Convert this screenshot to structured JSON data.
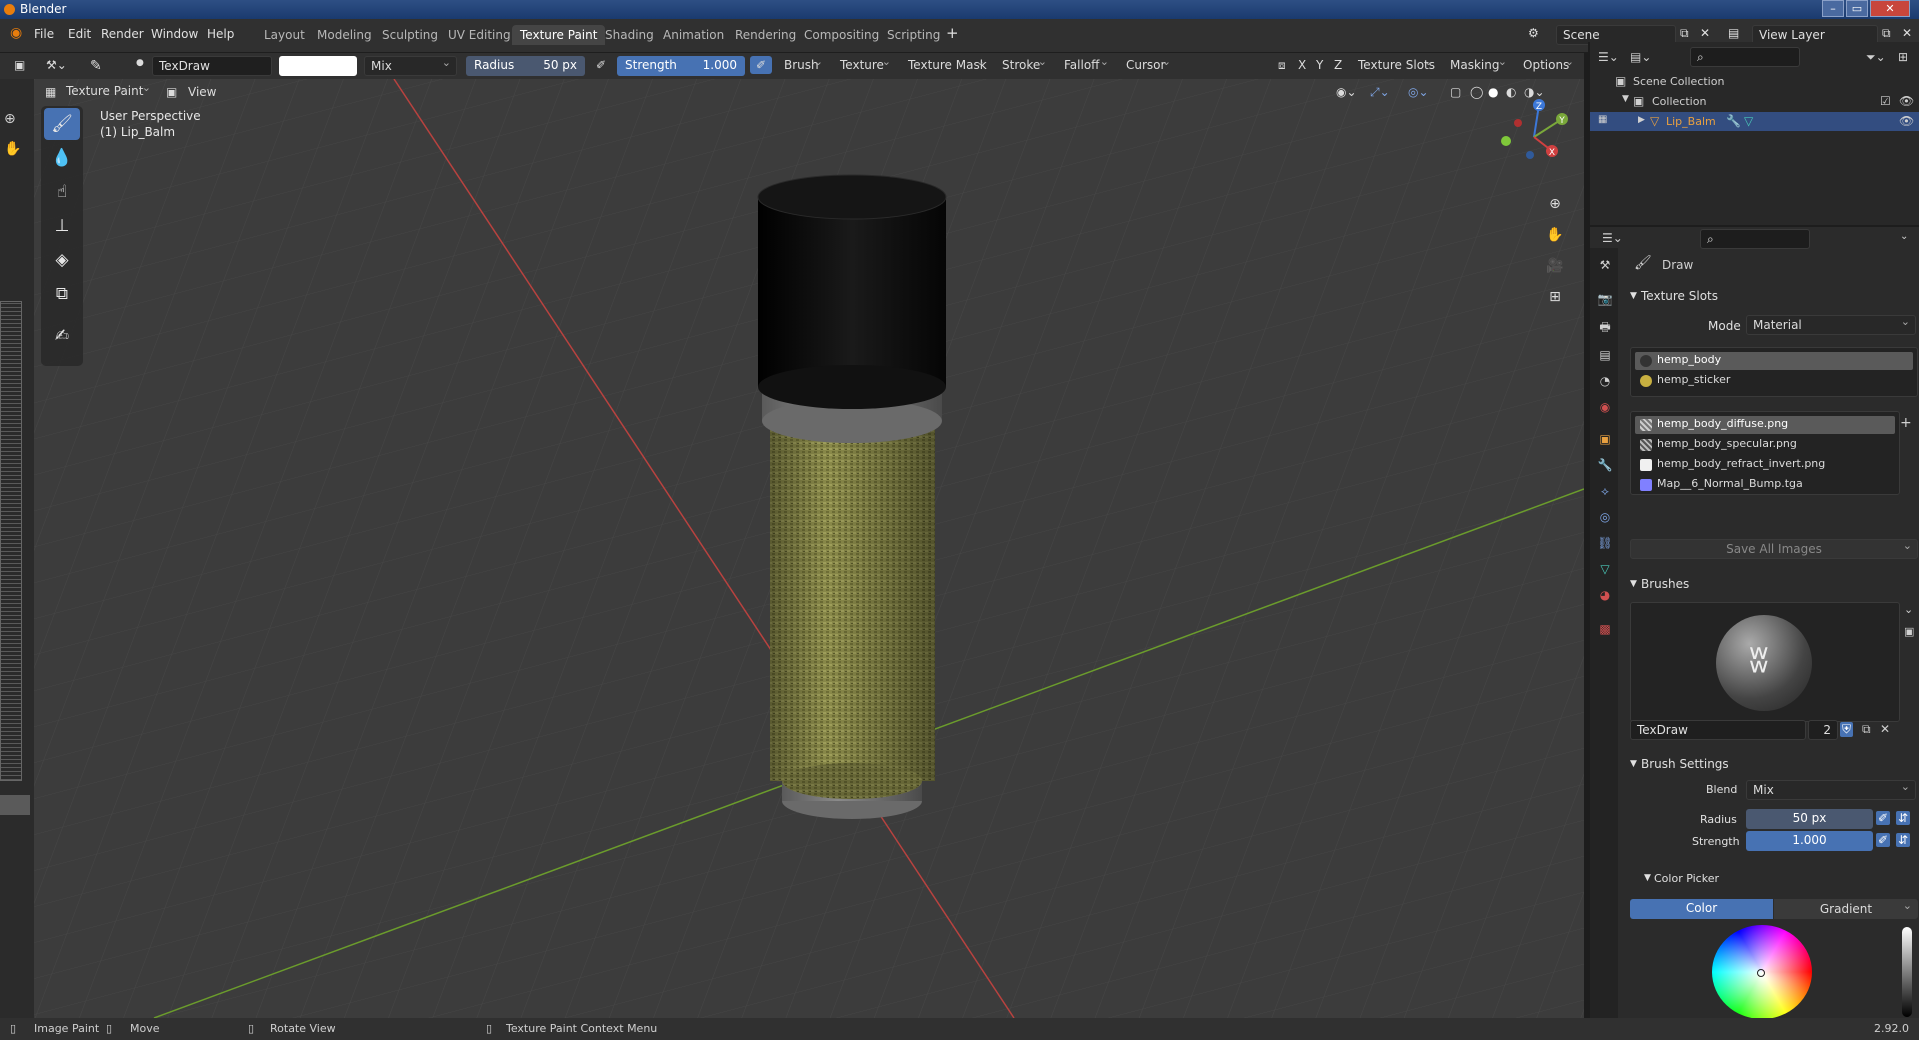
{
  "window": {
    "title": "Blender",
    "controls": [
      "–",
      "▭",
      "✕"
    ]
  },
  "menu": [
    "File",
    "Edit",
    "Render",
    "Window",
    "Help"
  ],
  "workspaces": [
    "Layout",
    "Modeling",
    "Sculpting",
    "UV Editing",
    "Texture Paint",
    "Shading",
    "Animation",
    "Rendering",
    "Compositing",
    "Scripting"
  ],
  "active_workspace": "Texture Paint",
  "scene": {
    "name": "Scene",
    "view_layer": "View Layer"
  },
  "tool_header": {
    "brush_name": "TexDraw",
    "blend": "Mix",
    "radius_label": "Radius",
    "radius_value": "50 px",
    "strength_label": "Strength",
    "strength_value": "1.000",
    "menus": [
      "Brush",
      "Texture",
      "Texture Mask",
      "Stroke",
      "Falloff",
      "Cursor"
    ],
    "axes": [
      "X",
      "Y",
      "Z"
    ],
    "right_menus": [
      "Texture Slots",
      "Masking",
      "Options"
    ]
  },
  "viewport_header": {
    "mode": "Texture Paint",
    "view": "View"
  },
  "viewport": {
    "perspective": "User Perspective",
    "object": "(1) Lip_Balm"
  },
  "gizmo": {
    "x": "X",
    "y": "Y",
    "z": "Z"
  },
  "outliner": {
    "scene_collection": "Scene Collection",
    "collection": "Collection",
    "object": "Lip_Balm"
  },
  "properties": {
    "tool_name": "Draw",
    "texture_slots": {
      "title": "Texture Slots",
      "mode_label": "Mode",
      "mode_value": "Material",
      "materials": [
        "hemp_body",
        "hemp_sticker"
      ],
      "images": [
        "hemp_body_diffuse.png",
        "hemp_body_specular.png",
        "hemp_body_refract_invert.png",
        "Map__6_Normal_Bump.tga"
      ],
      "save_all": "Save All Images"
    },
    "brushes": {
      "title": "Brushes",
      "brush_name": "TexDraw",
      "users": "2"
    },
    "brush_settings": {
      "title": "Brush Settings",
      "blend_label": "Blend",
      "blend_value": "Mix",
      "radius_label": "Radius",
      "radius_value": "50 px",
      "strength_label": "Strength",
      "strength_value": "1.000"
    },
    "color_picker": {
      "title": "Color Picker",
      "tabs": [
        "Color",
        "Gradient"
      ]
    }
  },
  "status": {
    "items": [
      "Image Paint",
      "Move",
      "Rotate View",
      "Texture Paint Context Menu"
    ],
    "version": "2.92.0"
  },
  "colors": {
    "accent": "#4772b3",
    "x_axis": "#d04040",
    "y_axis": "#7aa83a",
    "z_axis": "#3c78d8"
  }
}
